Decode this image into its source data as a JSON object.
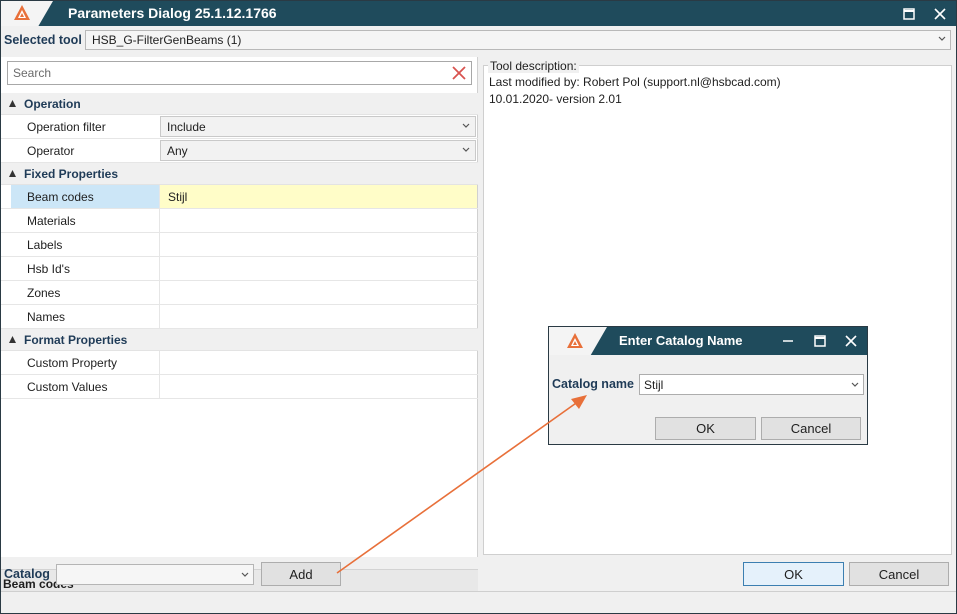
{
  "window": {
    "title": "Parameters Dialog 25.1.12.1766"
  },
  "tool": {
    "label": "Selected tool",
    "value": "HSB_G-FilterGenBeams (1)"
  },
  "search": {
    "placeholder": "Search"
  },
  "groups": {
    "operation": {
      "title": "Operation",
      "rows": [
        {
          "name": "Operation filter",
          "value": "Include"
        },
        {
          "name": "Operator",
          "value": "Any"
        }
      ]
    },
    "fixed": {
      "title": "Fixed Properties",
      "rows": [
        {
          "name": "Beam codes",
          "value": "Stijl"
        },
        {
          "name": "Materials",
          "value": ""
        },
        {
          "name": "Labels",
          "value": ""
        },
        {
          "name": "Hsb Id's",
          "value": ""
        },
        {
          "name": "Zones",
          "value": ""
        },
        {
          "name": "Names",
          "value": ""
        }
      ]
    },
    "format": {
      "title": "Format Properties",
      "rows": [
        {
          "name": "Custom Property",
          "value": ""
        },
        {
          "name": "Custom Values",
          "value": ""
        }
      ]
    }
  },
  "property_description": {
    "title": "Beam codes"
  },
  "tool_description": {
    "legend": "Tool description:",
    "lines": [
      "Last modified by: Robert Pol (support.nl@hsbcad.com)",
      "10.01.2020- version 2.01"
    ]
  },
  "bottom": {
    "catalog_label": "Catalog",
    "catalog_value": "",
    "add_label": "Add",
    "ok_label": "OK",
    "cancel_label": "Cancel"
  },
  "catalog_dialog": {
    "title": "Enter Catalog Name",
    "field_label": "Catalog name",
    "field_value": "Stijl",
    "ok_label": "OK",
    "cancel_label": "Cancel"
  },
  "colors": {
    "titlebar": "#1f4b5c",
    "selected_name": "#cce6f7",
    "selected_value": "#fffdc8",
    "annotation_arrow": "#e8703a",
    "logo": "#e8703a"
  },
  "icons": {
    "app_logo": "hsbcad-logo-icon",
    "maximize": "maximize-icon",
    "close": "close-icon",
    "minimize": "minimize-icon",
    "search_clear": "clear-search-icon",
    "dropdown": "chevron-down-icon",
    "collapse": "collapse-triangle-icon"
  }
}
